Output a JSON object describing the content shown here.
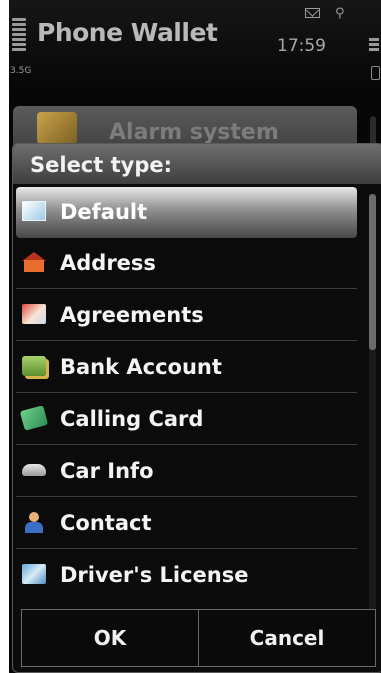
{
  "status": {
    "app_title": "Phone Wallet",
    "clock": "17:59",
    "network": "3.5G"
  },
  "background": {
    "item_label": "Alarm system"
  },
  "dialog": {
    "title": "Select type:",
    "options": [
      {
        "label": "Default",
        "icon": "default-icon",
        "selected": true
      },
      {
        "label": "Address",
        "icon": "house-icon"
      },
      {
        "label": "Agreements",
        "icon": "document-icon"
      },
      {
        "label": "Bank Account",
        "icon": "money-icon"
      },
      {
        "label": "Calling Card",
        "icon": "card-icon"
      },
      {
        "label": "Car Info",
        "icon": "car-icon"
      },
      {
        "label": "Contact",
        "icon": "person-icon"
      },
      {
        "label": "Driver's License",
        "icon": "id-card-icon"
      }
    ],
    "ok_label": "OK",
    "cancel_label": "Cancel"
  }
}
